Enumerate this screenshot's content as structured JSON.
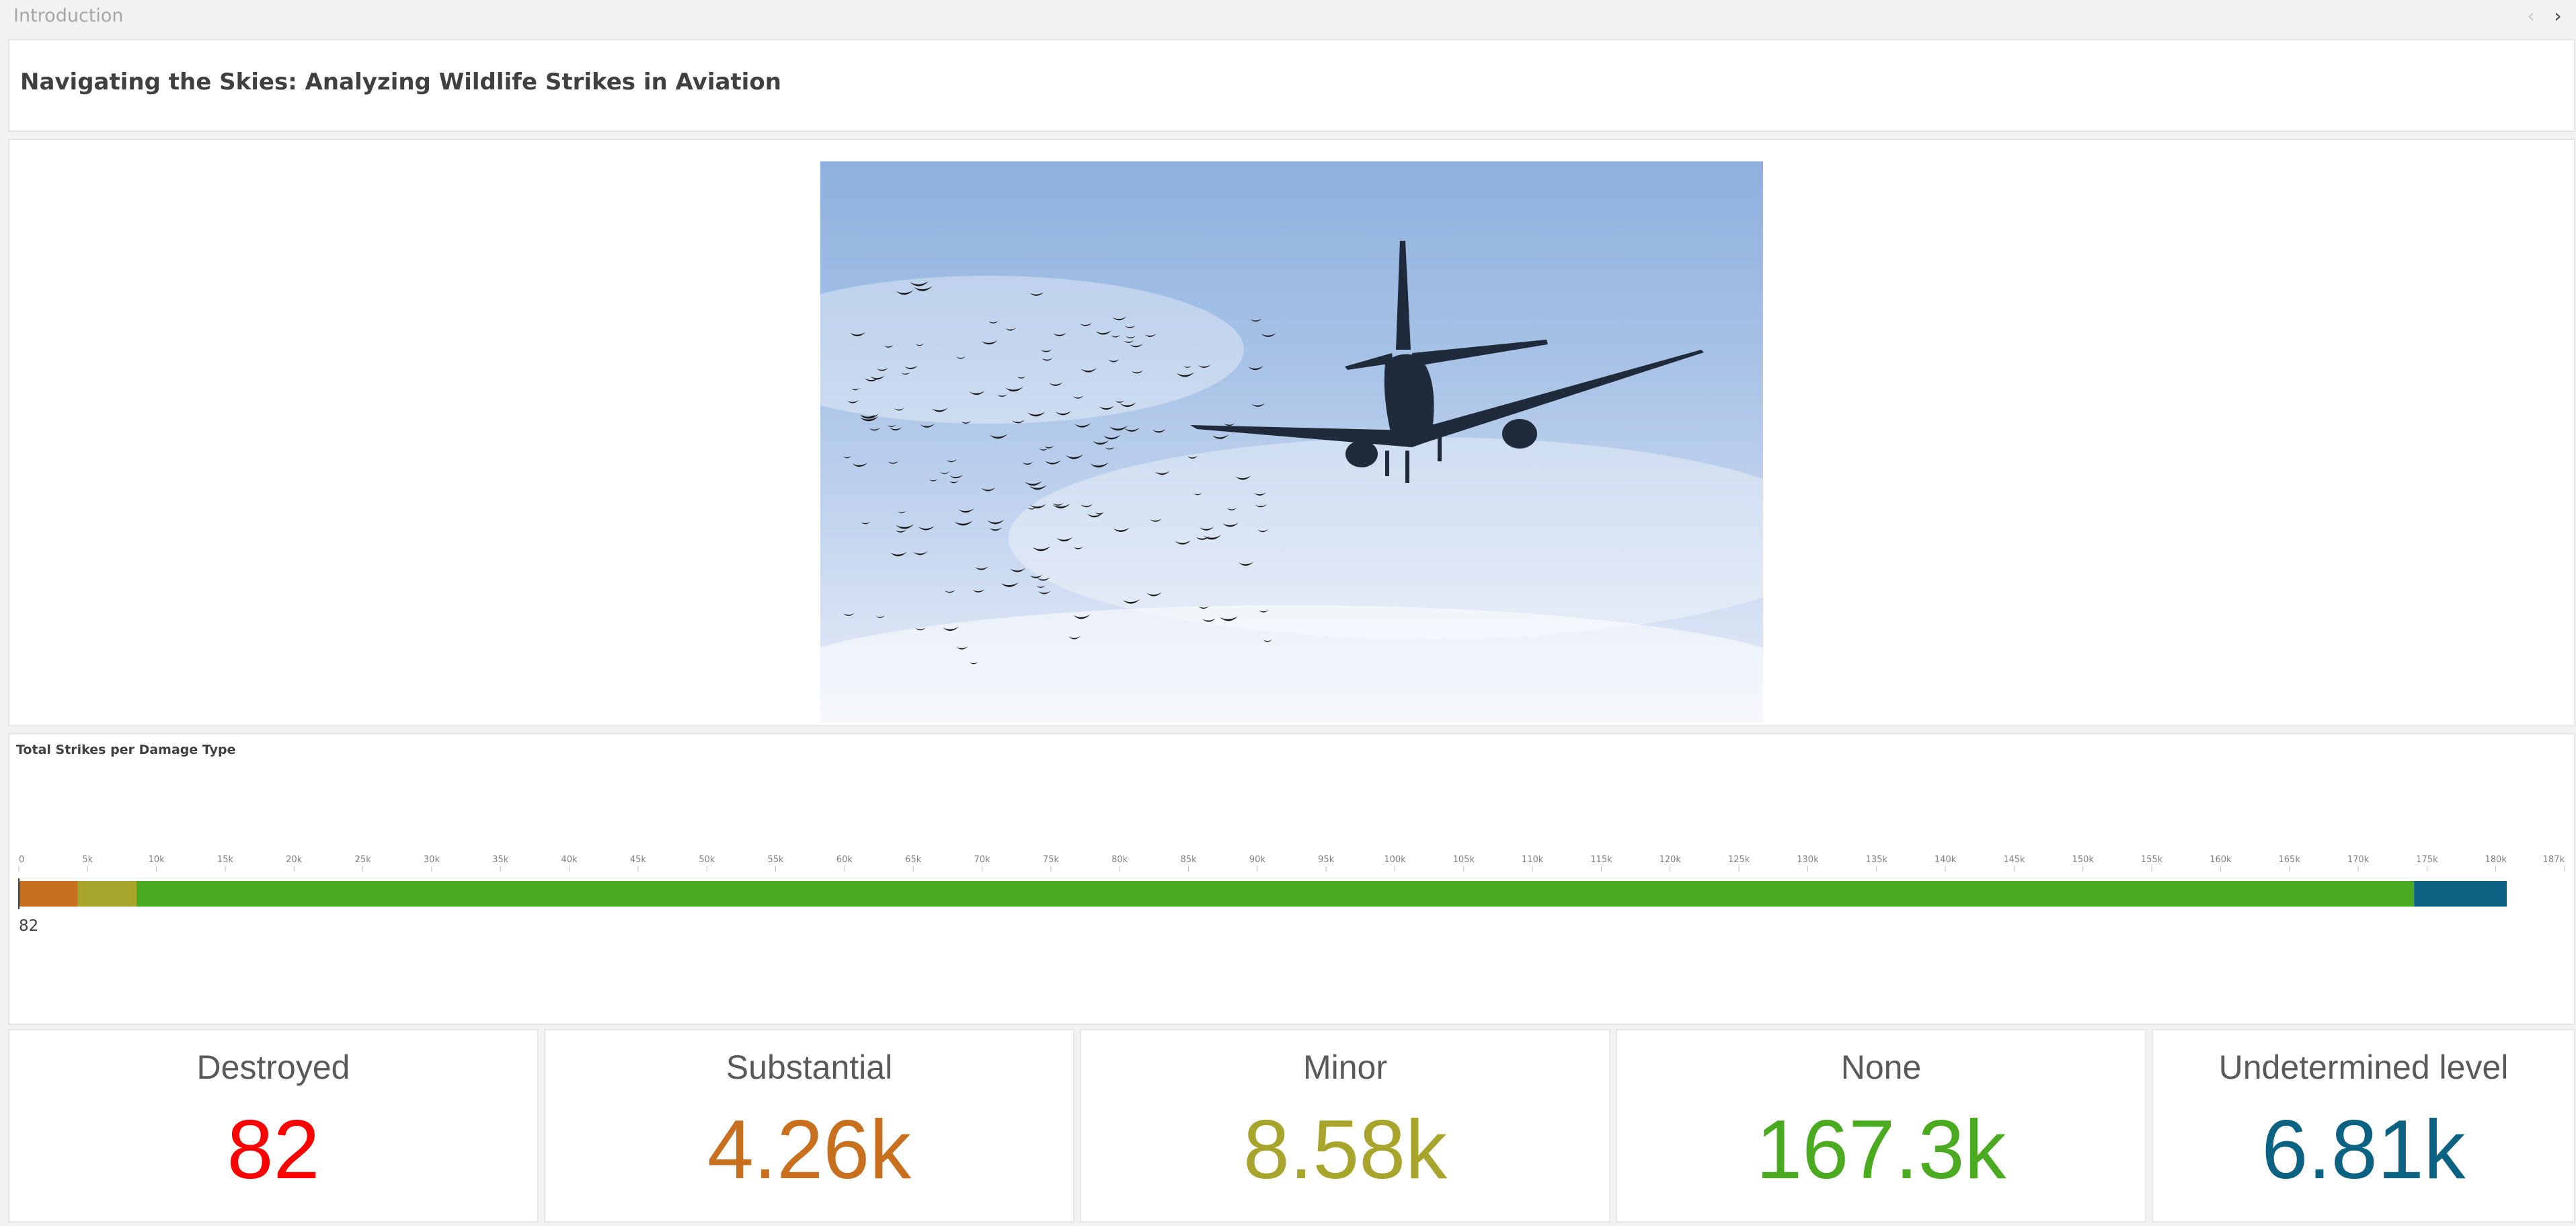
{
  "topbar": {
    "sheet_title": "Introduction",
    "prev_icon": "chevron-left-icon",
    "next_icon": "chevron-right-icon"
  },
  "header": {
    "title": "Navigating the Skies: Analyzing Wildlife Strikes in Aviation"
  },
  "chart_data": {
    "type": "bar",
    "orientation": "horizontal-stacked",
    "title": "Total Strikes per Damage Type",
    "x_ticks": [
      "0",
      "5k",
      "10k",
      "15k",
      "20k",
      "25k",
      "30k",
      "35k",
      "40k",
      "45k",
      "50k",
      "55k",
      "60k",
      "65k",
      "70k",
      "75k",
      "80k",
      "85k",
      "90k",
      "95k",
      "100k",
      "105k",
      "110k",
      "115k",
      "120k",
      "125k",
      "130k",
      "135k",
      "140k",
      "145k",
      "150k",
      "155k",
      "160k",
      "165k",
      "170k",
      "175k",
      "180k",
      "187k"
    ],
    "xlim": [
      0,
      187000
    ],
    "series": [
      {
        "name": "Destroyed",
        "value": 82,
        "color": "#ff0000"
      },
      {
        "name": "Substantial",
        "value": 4260,
        "color": "#c8701e"
      },
      {
        "name": "Minor",
        "value": 4300,
        "color": "#a8a52c"
      },
      {
        "name": "None",
        "value": 167300,
        "color": "#4aab20"
      },
      {
        "name": "Undetermined level",
        "value": 6810,
        "color": "#0b6283"
      }
    ],
    "bar_label": "82",
    "grid": false
  },
  "kpis": [
    {
      "label": "Destroyed",
      "value": "82",
      "color": "#ff0000"
    },
    {
      "label": "Substantial",
      "value": "4.26k",
      "color": "#c8701e"
    },
    {
      "label": "Minor",
      "value": "8.58k",
      "color": "#a8a52c"
    },
    {
      "label": "None",
      "value": "167.3k",
      "color": "#4aab20"
    },
    {
      "label": "Undetermined level",
      "value": "6.81k",
      "color": "#0b6283"
    }
  ]
}
